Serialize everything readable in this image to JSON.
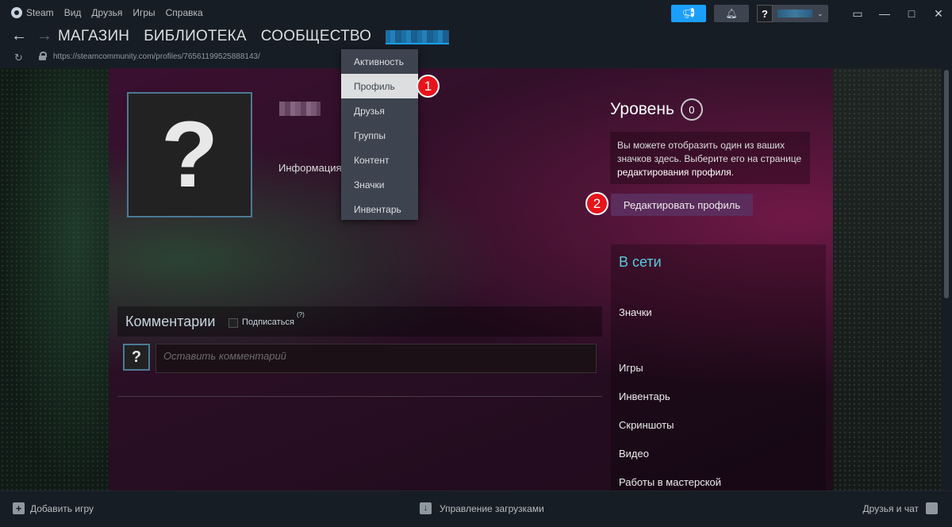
{
  "menubar": {
    "app_name": "Steam",
    "items": [
      "Вид",
      "Друзья",
      "Игры",
      "Справка"
    ]
  },
  "account": {
    "avatar_glyph": "?"
  },
  "nav": {
    "tabs": [
      "МАГАЗИН",
      "БИБЛИОТЕКА",
      "СООБЩЕСТВО"
    ]
  },
  "url": "https://steamcommunity.com/profiles/76561199525888143/",
  "dropdown": {
    "items": [
      "Активность",
      "Профиль",
      "Друзья",
      "Группы",
      "Контент",
      "Значки",
      "Инвентарь"
    ],
    "active_index": 1
  },
  "profile": {
    "avatar_glyph": "?",
    "info_label": "Информация"
  },
  "level": {
    "title": "Уровень",
    "value": "0",
    "badge_text_1": "Вы можете отобразить один из ваших значков здесь. Выберите его на странице ",
    "badge_link": "редактирования профиля",
    "badge_text_2": ".",
    "edit_button": "Редактировать профиль"
  },
  "online": {
    "status": "В сети",
    "links": [
      "Значки",
      "Игры",
      "Инвентарь",
      "Скриншоты",
      "Видео",
      "Работы в мастерской"
    ]
  },
  "comments": {
    "title": "Комментарии",
    "subscribe": "Подписаться",
    "help": "(?)",
    "avatar_glyph": "?",
    "placeholder": "Оставить комментарий"
  },
  "markers": [
    "1",
    "2"
  ],
  "bottombar": {
    "add_game": "Добавить игру",
    "downloads": "Управление загрузками",
    "friends": "Друзья и чат"
  },
  "colors": {
    "accent_blue": "#1a9fff",
    "edit_button": "#5b2d5c",
    "online_status": "#57cbde",
    "marker_red": "#e8141c"
  }
}
